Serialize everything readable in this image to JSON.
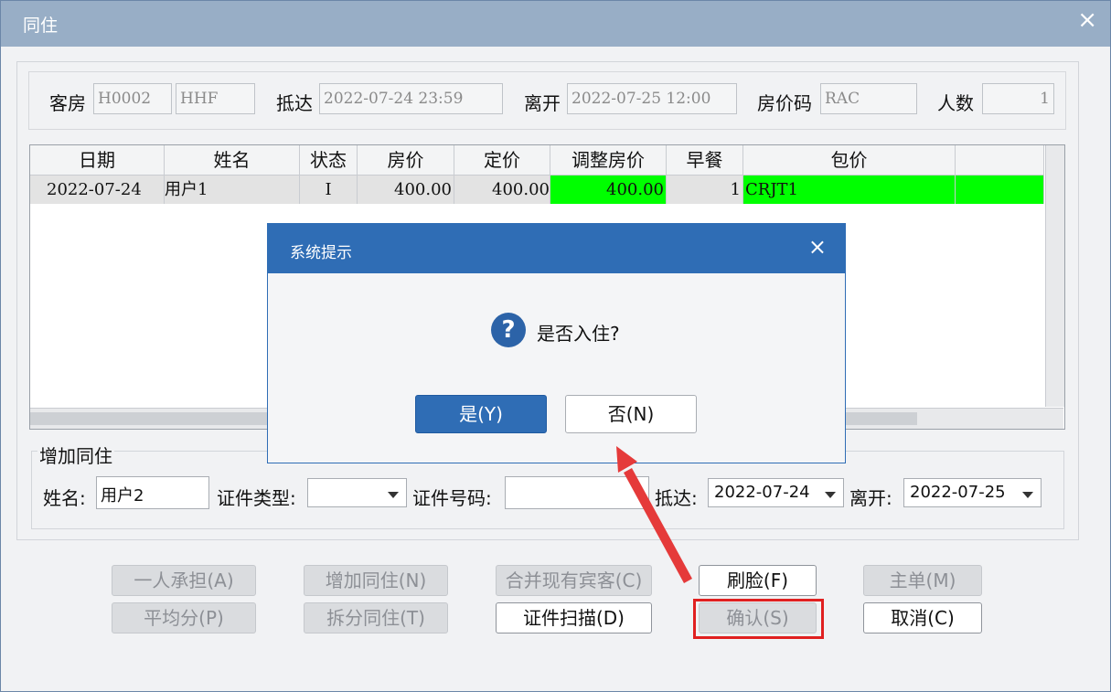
{
  "window": {
    "title": "同住",
    "close_glyph": "×"
  },
  "header": {
    "room_label": "客房",
    "room_code": "H0002",
    "room_type": "HHF",
    "arrive_label": "抵达",
    "arrive_value": "2022-07-24 23:59",
    "depart_label": "离开",
    "depart_value": "2022-07-25 12:00",
    "rate_code_label": "房价码",
    "rate_code_value": "RAC",
    "persons_label": "人数",
    "persons_value": "1"
  },
  "grid": {
    "columns": [
      "日期",
      "姓名",
      "状态",
      "房价",
      "定价",
      "调整房价",
      "早餐",
      "包价",
      ""
    ],
    "rows": [
      {
        "date": "2022-07-24",
        "name": "用户1",
        "status": "I",
        "rate": "400.00",
        "list_price": "400.00",
        "adjusted_rate": "400.00",
        "breakfast": "1",
        "package": "CRJT1",
        "extra": ""
      }
    ]
  },
  "add_section": {
    "legend": "增加同住",
    "name_label": "姓名:",
    "name_value": "用户2",
    "idtype_label": "证件类型:",
    "idtype_value": "",
    "idno_label": "证件号码:",
    "idno_value": "",
    "arrive_label": "抵达:",
    "arrive_value": "2022-07-24",
    "depart_label": "离开:",
    "depart_value": "2022-07-25"
  },
  "buttons": {
    "one_person": "一人承担(A)",
    "add_share": "增加同住(N)",
    "merge_guest": "合并现有宾客(C)",
    "face_scan": "刷脸(F)",
    "master": "主单(M)",
    "split_even": "平均分(P)",
    "split_share": "拆分同住(T)",
    "id_scan": "证件扫描(D)",
    "confirm": "确认(S)",
    "cancel": "取消(C)"
  },
  "dialog": {
    "title": "系统提示",
    "close_glyph": "×",
    "message": "是否入住?",
    "yes_label": "是(Y)",
    "no_label": "否(N)"
  },
  "colors": {
    "title_bar": "#98aec6",
    "dialog_title": "#2f6db5",
    "highlight_green": "#00ff00",
    "annotation_red": "#e02020"
  }
}
